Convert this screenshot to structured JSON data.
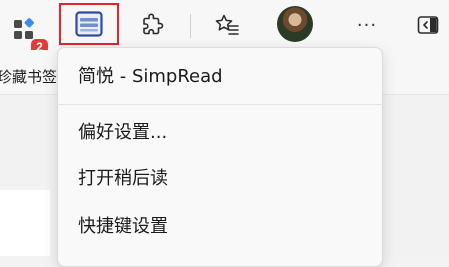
{
  "toolbar": {
    "extensions_badge": "2",
    "more_glyph": "···",
    "icons": [
      "extensions-icon",
      "simpread-icon",
      "puzzle-icon",
      "favorites-icon",
      "avatar",
      "more-icon",
      "sidebar-icon"
    ]
  },
  "bookmarks": {
    "label": "珍藏书签"
  },
  "menu": {
    "title": "简悦 - SimpRead",
    "items": [
      {
        "label": "偏好设置..."
      },
      {
        "label": "打开稍后读"
      },
      {
        "label": "快捷键设置"
      }
    ]
  },
  "colors": {
    "highlight_border": "#e3242b",
    "badge": "#e23b3b"
  }
}
